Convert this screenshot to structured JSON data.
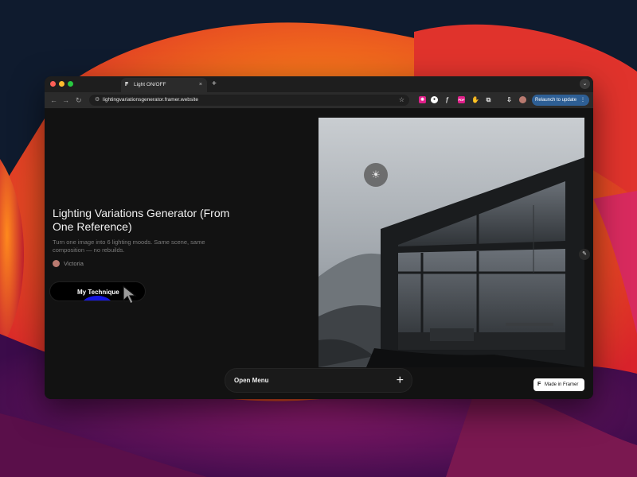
{
  "browser": {
    "tab": {
      "title": "Light ON/OFF",
      "close_glyph": "×",
      "favicon": "framer-icon"
    },
    "new_tab_glyph": "+",
    "url": "lightingvariationsgenerator.framer.website",
    "relaunch_label": "Relaunch to update",
    "relaunch_menu_glyph": "⋮",
    "colors": {
      "close": "#ff5f57",
      "minimize": "#febc2e",
      "maximize": "#28c840",
      "relaunch": "#2e5f95"
    },
    "extension_labels": [
      "ƒ",
      "PDF"
    ]
  },
  "page": {
    "headline": "Lighting Variations Generator (From One Reference)",
    "subtext": "Turn one image into 6 lighting moods. Same scene, same composition — no rebuilds.",
    "author": "Victoria",
    "technique_button": "My Technique",
    "menu_label": "Open Menu",
    "menu_plus": "+",
    "framer_badge": "Made in Framer",
    "sun_icon": "☀",
    "edit_icon": "✎"
  }
}
